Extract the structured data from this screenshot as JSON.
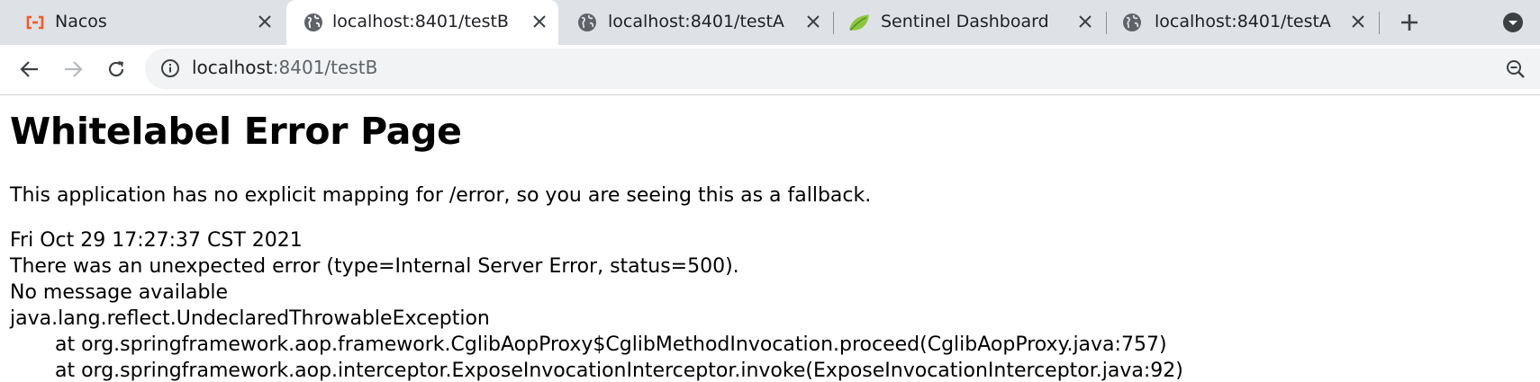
{
  "tabs": [
    {
      "title": "Nacos",
      "icon": "nacos-logo-icon",
      "active": false
    },
    {
      "title": "localhost:8401/testB",
      "icon": "globe-icon",
      "active": true
    },
    {
      "title": "localhost:8401/testA",
      "icon": "globe-icon",
      "active": false
    },
    {
      "title": "Sentinel Dashboard",
      "icon": "sentinel-leaf-icon",
      "active": false
    },
    {
      "title": "localhost:8401/testA",
      "icon": "globe-icon",
      "active": false
    }
  ],
  "toolbar": {
    "url_host": "localhost",
    "url_rest": ":8401/testB"
  },
  "page": {
    "heading": "Whitelabel Error Page",
    "description": "This application has no explicit mapping for /error, so you are seeing this as a fallback.",
    "timestamp": "Fri Oct 29 17:27:37 CST 2021",
    "error_line": "There was an unexpected error (type=Internal Server Error, status=500).",
    "message_line": "No message available",
    "exception": "java.lang.reflect.UndeclaredThrowableException",
    "stack": [
      "at org.springframework.aop.framework.CglibAopProxy$CglibMethodInvocation.proceed(CglibAopProxy.java:757)",
      "at org.springframework.aop.interceptor.ExposeInvocationInterceptor.invoke(ExposeInvocationInterceptor.java:92)"
    ]
  },
  "colors": {
    "tabstrip_bg": "#dee1e6",
    "active_tab_bg": "#ffffff",
    "omnibox_bg": "#f1f3f4",
    "nacos_orange": "#f05a28",
    "sentinel_green": "#8cc63f"
  }
}
